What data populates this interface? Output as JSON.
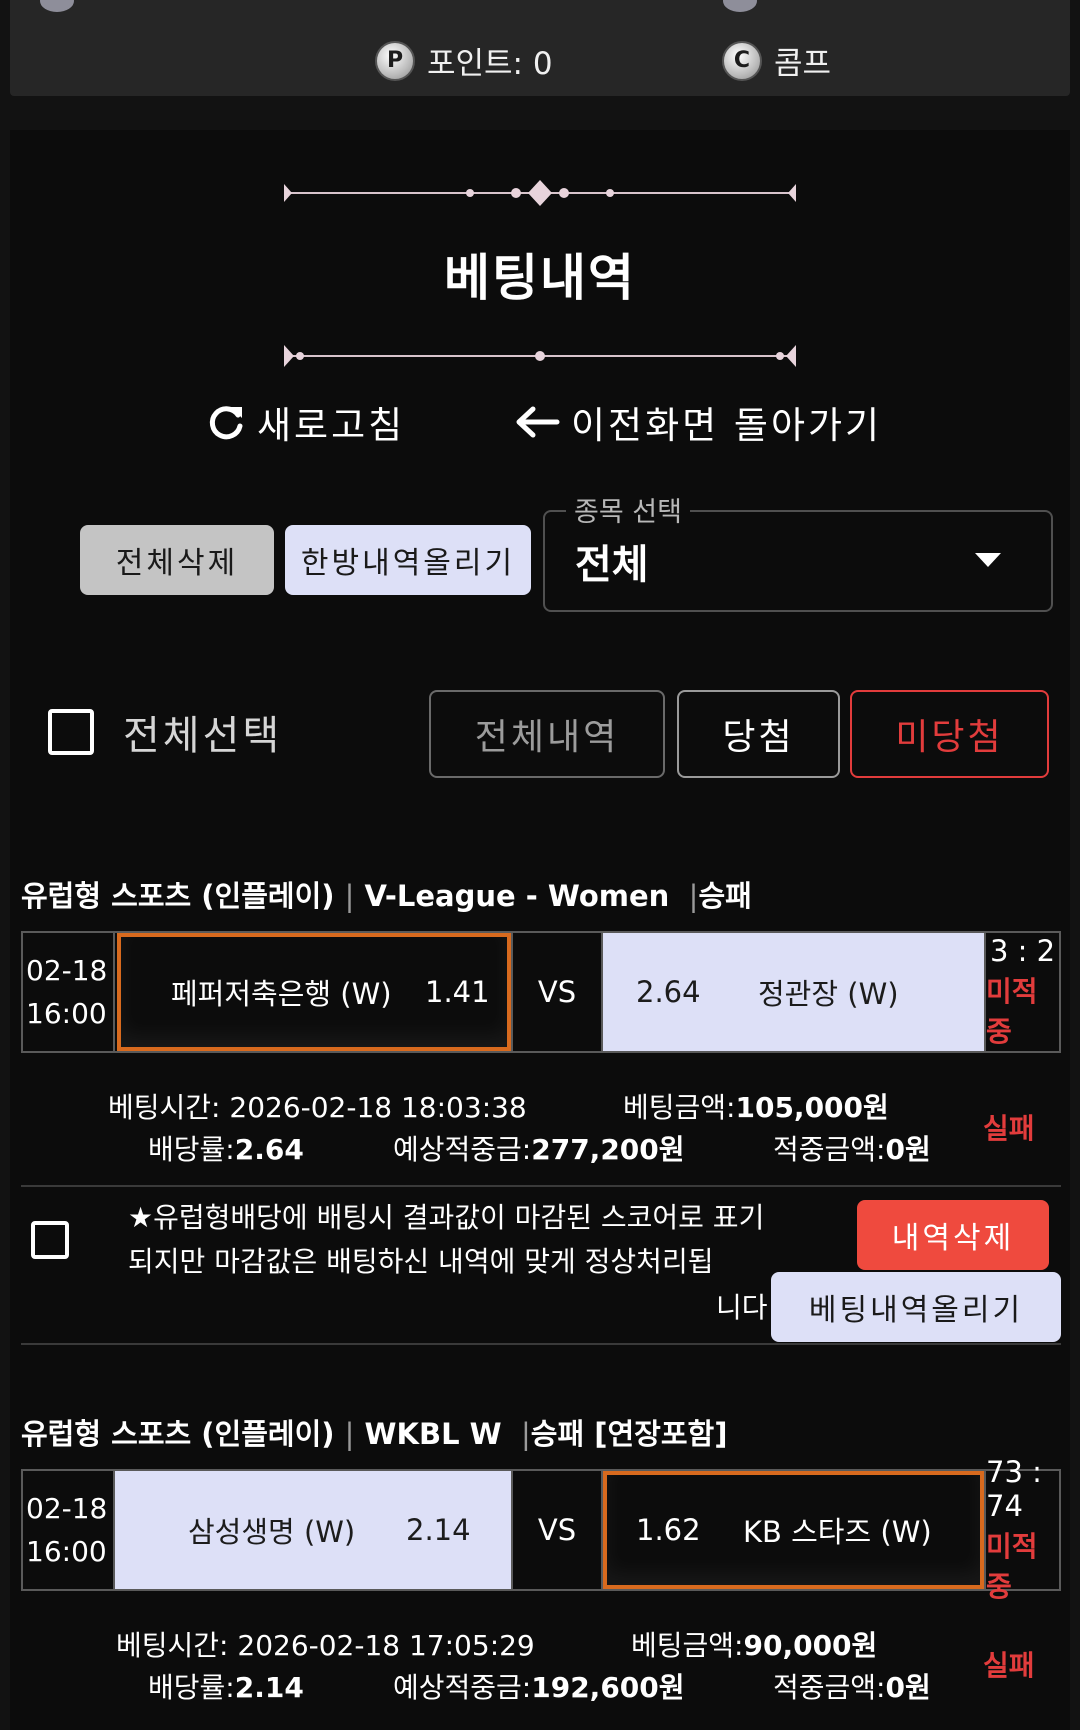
{
  "top": {
    "points_label": "포인트: 0",
    "comp_label": "콤프",
    "points_icon_letter": "P",
    "comp_icon_letter": "C"
  },
  "header": {
    "title": "베팅내역",
    "refresh_label": "새로고침",
    "back_label": "이전화면 돌아가기"
  },
  "toolbar": {
    "delete_all": "전체삭제",
    "upload_onehit": "한방내역올리기",
    "select_legend": "종목 선택",
    "select_value": "전체"
  },
  "filters": {
    "select_all": "전체선택",
    "tabs": [
      "전체내역",
      "당첨",
      "미당첨"
    ]
  },
  "colors": {
    "accent_red": "#e23c3c",
    "selected_border": "#d86a1e",
    "lavender": "#dde0f7",
    "delete_button": "#ef4a3e"
  },
  "bets": [
    {
      "title_main": "유럽형 스포츠 (인플레이)",
      "title_league": "V-League - Women",
      "title_market": "승패",
      "date": "02-18",
      "time": "16:00",
      "home_team": "페퍼저축은행 (W)",
      "home_odds": "1.41",
      "vs": "VS",
      "away_odds": "2.64",
      "away_team": "정관장 (W)",
      "score": "3 : 2",
      "status": "미적중",
      "bet_time": "베팅시간: 2026-02-18 18:03:38",
      "bet_amount_label": "베팅금액:",
      "bet_amount": "105,000원",
      "odds_label": "배당률:",
      "odds": "2.64",
      "expected_label": "예상적중금:",
      "expected": "277,200원",
      "win_label": "적중금액:",
      "win_amount": "0원",
      "result": "실패"
    },
    {
      "title_main": "유럽형 스포츠 (인플레이)",
      "title_league": "WKBL W",
      "title_market": "승패 [연장포함]",
      "date": "02-18",
      "time": "16:00",
      "home_team": "삼성생명 (W)",
      "home_odds": "2.14",
      "vs": "VS",
      "away_odds": "1.62",
      "away_team": "KB 스타즈 (W)",
      "score": "73 : 74",
      "status": "미적중",
      "bet_time": "베팅시간: 2026-02-18 17:05:29",
      "bet_amount_label": "베팅금액:",
      "bet_amount": "90,000원",
      "odds_label": "배당률:",
      "odds": "2.14",
      "expected_label": "예상적중금:",
      "expected": "192,600원",
      "win_label": "적중금액:",
      "win_amount": "0원",
      "result": "실패"
    }
  ],
  "notice": {
    "text": "★유럽형배당에 배팅시 결과값이 마감된 스코어로 표기되지만 마감값은 배팅하신 내역에 맞게 정상처리됩",
    "last": "니다",
    "delete_button": "내역삭제",
    "upload_button": "베팅내역올리기"
  }
}
